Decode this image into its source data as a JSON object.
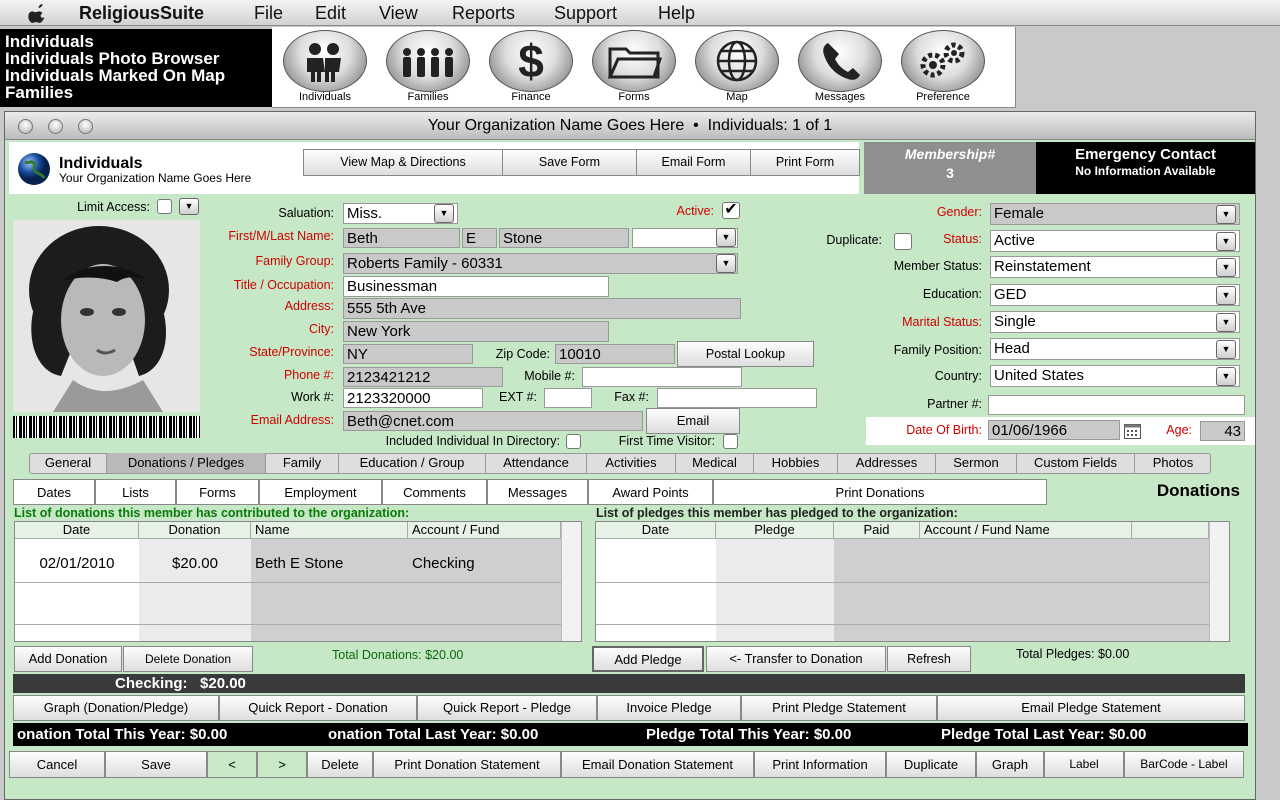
{
  "menubar": {
    "app": "ReligiousSuite",
    "items": [
      "File",
      "Edit",
      "View",
      "Reports",
      "Support",
      "Help"
    ]
  },
  "quick_links": [
    "Individuals",
    "Individuals Photo Browser",
    "Individuals Marked On Map",
    "Families"
  ],
  "toolbar": [
    {
      "label": "Individuals",
      "icon": "people-icon"
    },
    {
      "label": "Families",
      "icon": "family-icon"
    },
    {
      "label": "Finance",
      "icon": "dollar-icon"
    },
    {
      "label": "Forms",
      "icon": "folder-icon"
    },
    {
      "label": "Map",
      "icon": "globe-icon"
    },
    {
      "label": "Messages",
      "icon": "phone-icon"
    },
    {
      "label": "Preference",
      "icon": "gears-icon"
    }
  ],
  "window": {
    "title": "Your Organization Name Goes Here  •  Individuals: 1 of 1"
  },
  "header": {
    "title": "Individuals",
    "subtitle": "Your Organization Name Goes Here",
    "buttons": [
      "View Map & Directions",
      "Save Form",
      "Email Form",
      "Print Form"
    ]
  },
  "membership": {
    "label": "Membership#",
    "value": "3"
  },
  "emergency": {
    "title": "Emergency Contact",
    "text": "No Information Available"
  },
  "form": {
    "limit_access": "Limit Access:",
    "salutation_label": "Saluation:",
    "salutation": "Miss.",
    "active_label": "Active:",
    "active_mark": "✔",
    "name_label": "First/M/Last Name:",
    "first": "Beth",
    "middle": "E",
    "last": "Stone",
    "family_label": "Family Group:",
    "family": "Roberts Family - 60331",
    "title_label": "Title / Occupation:",
    "title": "Businessman",
    "address_label": "Address:",
    "address": "555 5th Ave",
    "city_label": "City:",
    "city": "New York",
    "state_label": "State/Province:",
    "state": "NY",
    "zip_label": "Zip Code:",
    "zip": "10010",
    "postal_lookup": "Postal Lookup",
    "phone_label": "Phone #:",
    "phone": "2123421212",
    "mobile_label": "Mobile #:",
    "work_label": "Work #:",
    "work": "2123320000",
    "ext_label": "EXT #:",
    "fax_label": "Fax #:",
    "email_label": "Email Address:",
    "email": "Beth@cnet.com",
    "email_button": "Email",
    "directory_label": "Included Individual In Directory:",
    "first_time_label": "First Time Visitor:",
    "duplicate_label": "Duplicate:",
    "gender_label": "Gender:",
    "gender": "Female",
    "status_label": "Status:",
    "status": "Active",
    "member_status_label": "Member Status:",
    "member_status": "Reinstatement",
    "education_label": "Education:",
    "education": "GED",
    "marital_label": "Marital Status:",
    "marital": "Single",
    "family_position_label": "Family Position:",
    "family_position": "Head",
    "country_label": "Country:",
    "country": "United States",
    "partner_label": "Partner #:",
    "dob_label": "Date Of Birth:",
    "dob": "01/06/1966",
    "age_label": "Age:",
    "age": "43"
  },
  "tabs": [
    "General",
    "Donations / Pledges",
    "Family",
    "Education / Group",
    "Attendance",
    "Activities",
    "Medical",
    "Hobbies",
    "Addresses",
    "Sermon",
    "Custom Fields",
    "Photos"
  ],
  "subtabs": [
    "Dates",
    "Lists",
    "Forms",
    "Employment",
    "Comments",
    "Messages",
    "Award Points",
    "Print Donations"
  ],
  "donations_title": "Donations",
  "donations": {
    "caption": "List of donations this member has contributed to the organization:",
    "columns": [
      "Date",
      "Donation",
      "Name",
      "Account / Fund"
    ],
    "rows": [
      [
        "02/01/2010",
        "$20.00",
        "Beth E Stone",
        "Checking"
      ]
    ],
    "add": "Add Donation",
    "delete": "Delete Donation",
    "total": "Total Donations: $20.00"
  },
  "pledges": {
    "caption": "List of pledges this member has pledged to the organization:",
    "columns": [
      "Date",
      "Pledge",
      "Paid",
      "Account / Fund Name"
    ],
    "add": "Add Pledge",
    "transfer": "<- Transfer to Donation",
    "refresh": "Refresh",
    "total": "Total Pledges: $0.00"
  },
  "checking_summary": "Checking:   $20.00",
  "report_buttons": [
    "Graph (Donation/Pledge)",
    "Quick Report - Donation",
    "Quick Report - Pledge",
    "Invoice Pledge",
    "Print Pledge Statement",
    "Email Pledge Statement"
  ],
  "totals": [
    "onation Total This Year: $0.00",
    "onation Total Last Year: $0.00",
    "Pledge Total This Year: $0.00",
    "Pledge Total Last Year: $0.00"
  ],
  "bottom_buttons": [
    "Cancel",
    "Save",
    "<",
    ">",
    "Delete",
    "Print Donation Statement",
    "Email Donation Statement",
    "Print Information",
    "Duplicate",
    "Graph",
    "Label",
    "BarCode - Label"
  ]
}
